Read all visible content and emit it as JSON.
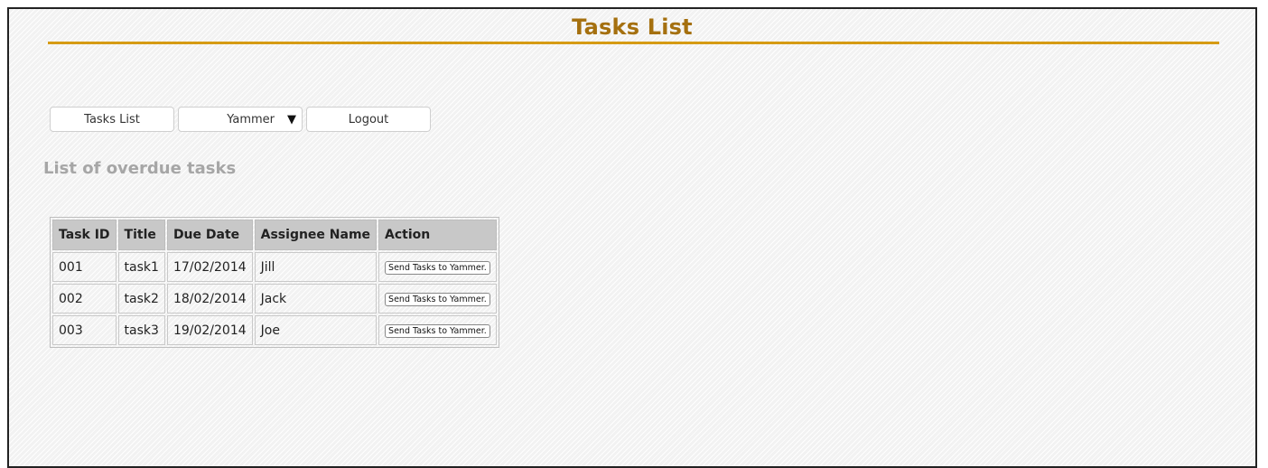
{
  "page": {
    "title": "Tasks List"
  },
  "nav": {
    "tasks_list": "Tasks List",
    "yammer": "Yammer",
    "yammer_caret": "▼",
    "logout": "Logout"
  },
  "section": {
    "heading": "List of overdue tasks"
  },
  "table": {
    "headers": [
      "Task ID",
      "Title",
      "Due Date",
      "Assignee Name",
      "Action"
    ],
    "rows": [
      {
        "id": "001",
        "title": "task1",
        "due": "17/02/2014",
        "assignee": "Jill",
        "action": "Send Tasks to Yammer."
      },
      {
        "id": "002",
        "title": "task2",
        "due": "18/02/2014",
        "assignee": "Jack",
        "action": "Send Tasks to Yammer."
      },
      {
        "id": "003",
        "title": "task3",
        "due": "19/02/2014",
        "assignee": "Joe",
        "action": "Send Tasks to Yammer."
      }
    ]
  },
  "colors": {
    "title": "#a5700f",
    "rule": "#d69b14",
    "heading": "#a6a6a6",
    "table_header_bg": "#c8c8c8"
  }
}
